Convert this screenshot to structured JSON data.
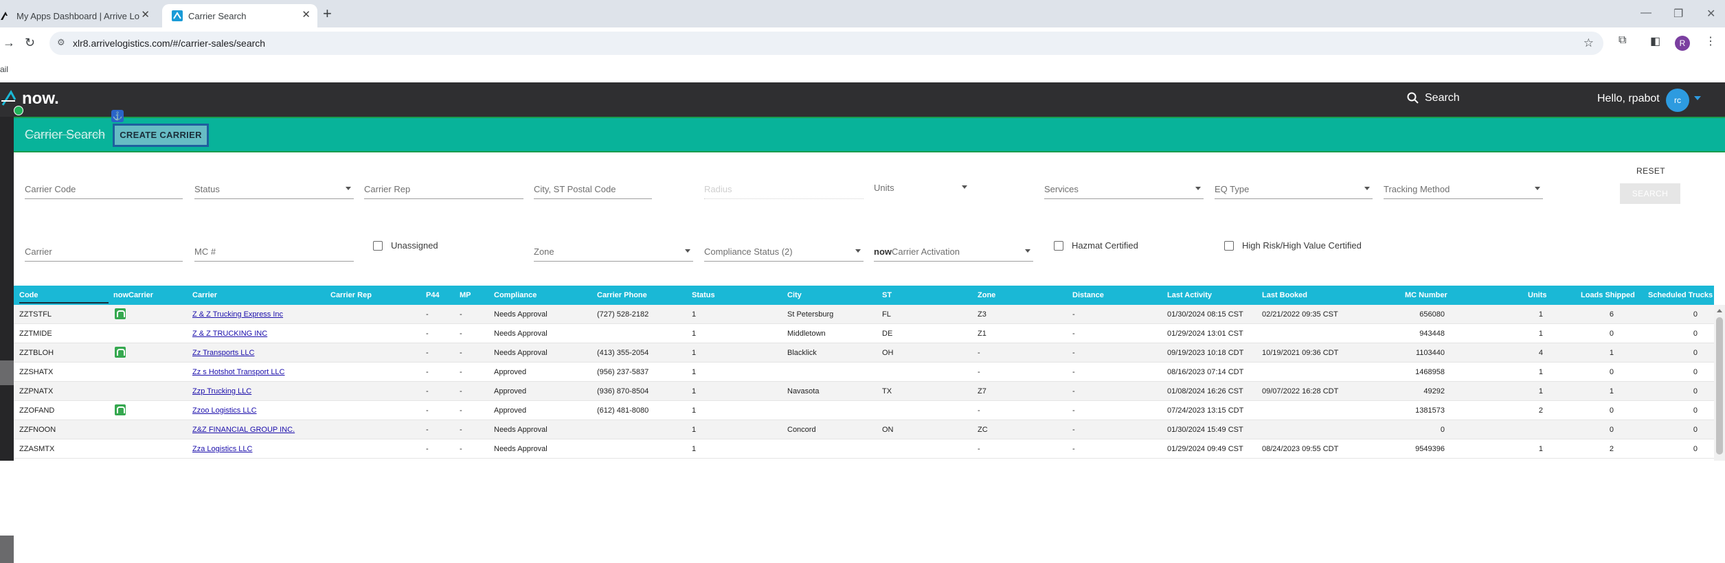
{
  "browser": {
    "tabs": [
      {
        "title": "My Apps Dashboard | Arrive Lo",
        "icon": "okta-icon"
      },
      {
        "title": "Carrier Search",
        "icon": "arrive-logo-icon"
      }
    ],
    "url": "xlr8.arrivelogistics.com/#/carrier-sales/search",
    "bookmark": "ail",
    "profile_initial": "R"
  },
  "header": {
    "logo_text": "now.",
    "search_label": "Search",
    "greeting": "Hello, rpabot",
    "avatar_initials": "rc"
  },
  "toolbar": {
    "title": "Carrier Search",
    "create_label": "CREATE CARRIER"
  },
  "filters": {
    "carrier_code": "Carrier Code",
    "status": "Status",
    "carrier_rep": "Carrier Rep",
    "city_st_postal": "City, ST Postal Code",
    "radius": "Radius",
    "units": "Units",
    "services": "Services",
    "eq_type": "EQ Type",
    "tracking_method": "Tracking Method",
    "reset": "RESET",
    "search": "SEARCH",
    "carrier": "Carrier",
    "mc_number": "MC #",
    "unassigned": "Unassigned",
    "zone": "Zone",
    "compliance_status": "Compliance Status (2)",
    "activation_prefix": "now",
    "activation": "Carrier Activation",
    "hazmat": "Hazmat Certified",
    "high_risk": "High Risk/High Value Certified"
  },
  "table": {
    "columns": [
      "Code",
      "nowCarrier",
      "Carrier",
      "Carrier Rep",
      "P44",
      "MP",
      "Compliance",
      "Carrier Phone",
      "Status",
      "City",
      "ST",
      "Zone",
      "Distance",
      "Last Activity",
      "Last Booked",
      "MC Number",
      "Units",
      "Loads Shipped",
      "Scheduled Trucks"
    ],
    "rows": [
      {
        "code": "ZZTSTFL",
        "now": true,
        "carrier": "Z & Z Trucking Express Inc",
        "rep": "",
        "p44": "-",
        "mp": "-",
        "compliance": "Needs Approval",
        "phone": "(727) 528-2182",
        "status": "1",
        "city": "St Petersburg",
        "st": "FL",
        "zone": "Z3",
        "distance": "-",
        "last_activity": "01/30/2024 08:15 CST",
        "last_booked": "02/21/2022 09:35 CST",
        "mc": "656080",
        "units": "1",
        "loads": "6",
        "trucks": "0"
      },
      {
        "code": "ZZTMIDE",
        "now": false,
        "carrier": "Z & Z TRUCKING INC",
        "rep": "",
        "p44": "-",
        "mp": "-",
        "compliance": "Needs Approval",
        "phone": "",
        "status": "1",
        "city": "Middletown",
        "st": "DE",
        "zone": "Z1",
        "distance": "-",
        "last_activity": "01/29/2024 13:01 CST",
        "last_booked": "",
        "mc": "943448",
        "units": "1",
        "loads": "0",
        "trucks": "0"
      },
      {
        "code": "ZZTBLOH",
        "now": true,
        "carrier": "Zz Transports LLC",
        "rep": "",
        "p44": "-",
        "mp": "-",
        "compliance": "Needs Approval",
        "phone": "(413) 355-2054",
        "status": "1",
        "city": "Blacklick",
        "st": "OH",
        "zone": "-",
        "distance": "-",
        "last_activity": "09/19/2023 10:18 CDT",
        "last_booked": "10/19/2021 09:36 CDT",
        "mc": "1103440",
        "units": "4",
        "loads": "1",
        "trucks": "0"
      },
      {
        "code": "ZZSHATX",
        "now": false,
        "carrier": "Zz s Hotshot Transport LLC",
        "rep": "",
        "p44": "-",
        "mp": "-",
        "compliance": "Approved",
        "phone": "(956) 237-5837",
        "status": "1",
        "city": "",
        "st": "",
        "zone": "-",
        "distance": "-",
        "last_activity": "08/16/2023 07:14 CDT",
        "last_booked": "",
        "mc": "1468958",
        "units": "1",
        "loads": "0",
        "trucks": "0"
      },
      {
        "code": "ZZPNATX",
        "now": false,
        "carrier": "Zzp Trucking LLC",
        "rep": "",
        "p44": "-",
        "mp": "-",
        "compliance": "Approved",
        "phone": "(936) 870-8504",
        "status": "1",
        "city": "Navasota",
        "st": "TX",
        "zone": "Z7",
        "distance": "-",
        "last_activity": "01/08/2024 16:26 CST",
        "last_booked": "09/07/2022 16:28 CDT",
        "mc": "49292",
        "units": "1",
        "loads": "1",
        "trucks": "0"
      },
      {
        "code": "ZZOFAND",
        "now": true,
        "carrier": "Zzoo Logistics LLC",
        "rep": "",
        "p44": "-",
        "mp": "-",
        "compliance": "Approved",
        "phone": "(612) 481-8080",
        "status": "1",
        "city": "",
        "st": "",
        "zone": "-",
        "distance": "-",
        "last_activity": "07/24/2023 13:15 CDT",
        "last_booked": "",
        "mc": "1381573",
        "units": "2",
        "loads": "0",
        "trucks": "0"
      },
      {
        "code": "ZZFNOON",
        "now": false,
        "carrier": "Z&Z FINANCIAL GROUP INC.",
        "rep": "",
        "p44": "-",
        "mp": "-",
        "compliance": "Needs Approval",
        "phone": "",
        "status": "1",
        "city": "Concord",
        "st": "ON",
        "zone": "ZC",
        "distance": "-",
        "last_activity": "01/30/2024 15:49 CST",
        "last_booked": "",
        "mc": "0",
        "units": "",
        "loads": "0",
        "trucks": "0"
      },
      {
        "code": "ZZASMTX",
        "now": false,
        "carrier": "Zza Logistics LLC",
        "rep": "",
        "p44": "-",
        "mp": "-",
        "compliance": "Needs Approval",
        "phone": "",
        "status": "1",
        "city": "",
        "st": "",
        "zone": "-",
        "distance": "-",
        "last_activity": "01/29/2024 09:49 CST",
        "last_booked": "08/24/2023 09:55 CDT",
        "mc": "9549396",
        "units": "1",
        "loads": "2",
        "trucks": "0"
      }
    ]
  },
  "colors": {
    "header_bg": "#2f2f31",
    "toolbar_green": "#08b39a",
    "table_header": "#1ab8d6",
    "badge_green": "#35a84f"
  }
}
